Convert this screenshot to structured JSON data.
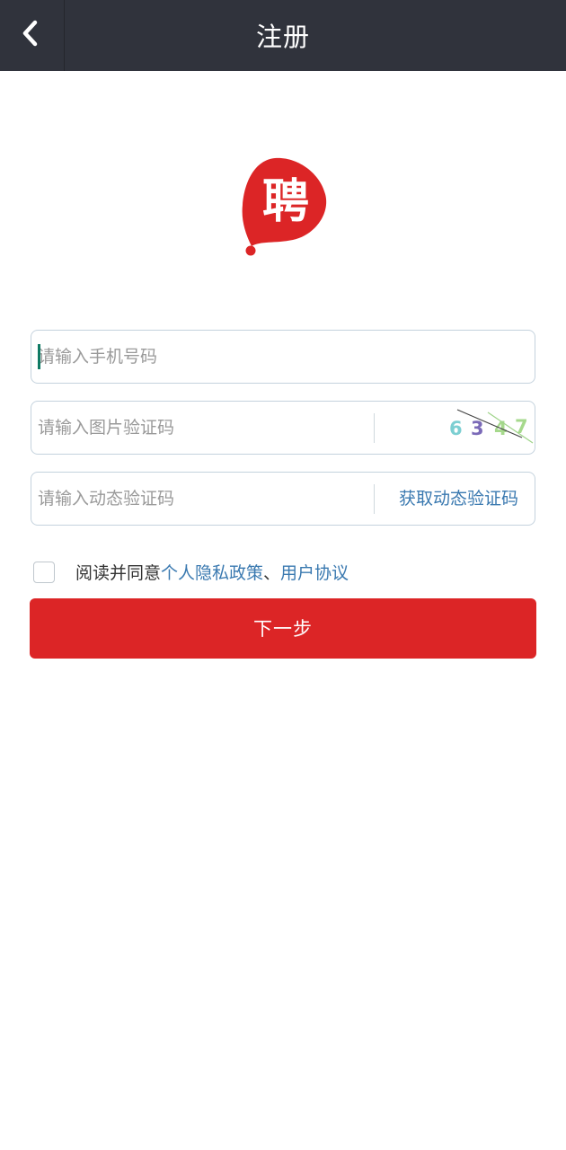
{
  "header": {
    "title": "注册",
    "back_icon": "chevron-left-icon"
  },
  "logo": {
    "text": "聘",
    "color": "#dc2526"
  },
  "form": {
    "phone_placeholder": "请输入手机号码",
    "captcha_placeholder": "请输入图片验证码",
    "captcha_text": [
      "6",
      "3",
      "4",
      "7"
    ],
    "sms_placeholder": "请输入动态验证码",
    "sms_button": "获取动态验证码"
  },
  "agreement": {
    "prefix": "阅读并同意",
    "privacy_link": "个人隐私政策",
    "separator": "、",
    "user_link": "用户协议",
    "checked": false
  },
  "submit_label": "下一步",
  "colors": {
    "header_bg": "#30333c",
    "primary": "#dc2526",
    "link": "#3a79b0",
    "border": "#c4d2dd"
  }
}
